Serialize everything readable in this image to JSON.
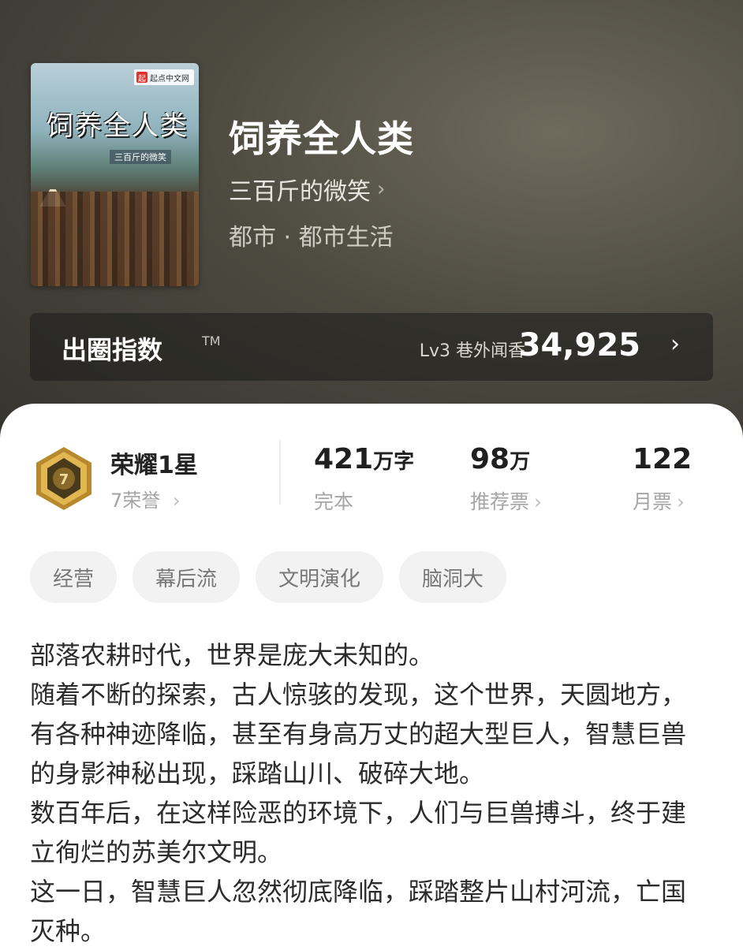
{
  "book": {
    "cover_logo": "起点中文网",
    "cover_title": "饲养全人类",
    "cover_author": "三百斤的微笑",
    "title": "饲养全人类",
    "author": "三百斤的微笑",
    "genre": "都市 · 都市生活"
  },
  "index_bar": {
    "label": "出圈指数",
    "tm": "TM",
    "level": "Lv3 巷外闻香",
    "score": "34,925"
  },
  "honor": {
    "title": "荣耀1星",
    "sub": "7荣誉",
    "badge_number": "7"
  },
  "stats": [
    {
      "value": "421",
      "unit": "万字",
      "label": "完本"
    },
    {
      "value": "98",
      "unit": "万",
      "label": "推荐票"
    },
    {
      "value": "122",
      "unit": "",
      "label": "月票"
    }
  ],
  "tags": [
    "经营",
    "幕后流",
    "文明演化",
    "脑洞大"
  ],
  "description": [
    "部落农耕时代，世界是庞大未知的。",
    "随着不断的探索，古人惊骇的发现，这个世界，天圆地方，有各种神迹降临，甚至有身高万丈的超大型巨人，智慧巨兽的身影神秘出现，踩踏山川、破碎大地。",
    "数百年后，在这样险恶的环境下，人们与巨兽搏斗，终于建立徇烂的苏美尔文明。",
    "这一日，智慧巨人忽然彻底降临，踩踏整片山村河流，亡国灭种。"
  ],
  "icons": [
    "chevron-right-icon",
    "honor-badge-icon",
    "cover-logo-icon"
  ],
  "colors": {
    "hero_bg": "#4d4a40",
    "index_bar_bg": "#2a2a26",
    "sheet_bg": "#ffffff",
    "badge_gold": "#c9a144"
  }
}
